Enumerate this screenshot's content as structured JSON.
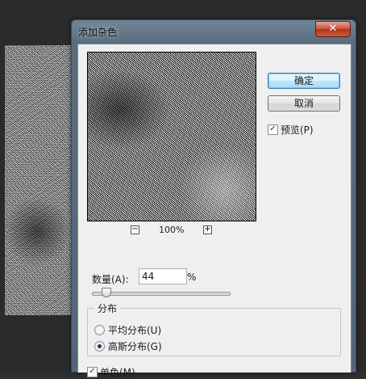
{
  "window": {
    "title": "添加杂色",
    "close_glyph": "✕"
  },
  "preview": {
    "zoom_out_glyph": "−",
    "zoom_in_glyph": "+",
    "zoom_level": "100%"
  },
  "buttons": {
    "ok_label": "确定",
    "cancel_label": "取消"
  },
  "preview_toggle": {
    "label": "预览(P)",
    "checked": true,
    "check_glyph": "✓"
  },
  "amount": {
    "label": "数量(A):",
    "value": "44",
    "unit": "%",
    "slider_fraction": 0.11
  },
  "distribution": {
    "title": "分布",
    "options": [
      {
        "label": "平均分布(U)",
        "selected": false
      },
      {
        "label": "高斯分布(G)",
        "selected": true
      }
    ]
  },
  "monochromatic": {
    "label": "单色(M)",
    "checked": true,
    "check_glyph": "✓"
  },
  "colors": {
    "close_button": "#c8503a",
    "default_button_accent": "#3c7fb1",
    "titlebar": "#5a6d7e"
  }
}
